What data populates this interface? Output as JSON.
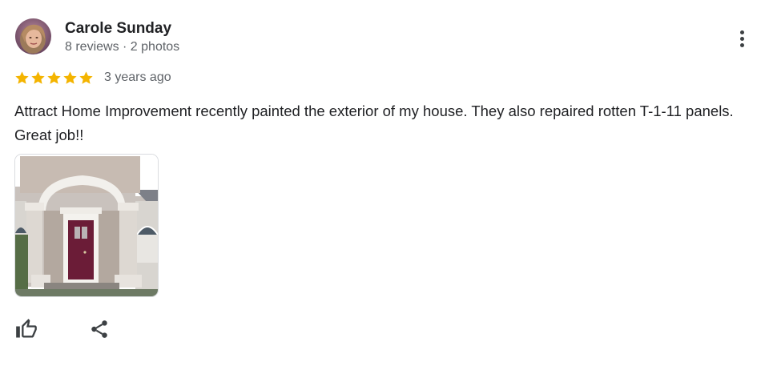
{
  "review": {
    "author_name": "Carole Sunday",
    "author_meta": "8 reviews · 2 photos",
    "rating": 5,
    "rating_max": 5,
    "time_ago": "3 years ago",
    "text": "Attract Home Improvement recently painted the exterior of my house. They also repaired rotten T-1-11 panels. Great job!!",
    "photo_count": 1
  },
  "icons": {
    "avatar": "avatar-photo",
    "more": "more-vert-icon",
    "star": "star-icon",
    "like": "thumb-up-icon",
    "share": "share-icon"
  },
  "colors": {
    "star": "#f4b400",
    "author": "#202124",
    "secondary": "#5f6368",
    "icon": "#3c4043",
    "door": "#6b1c37"
  }
}
